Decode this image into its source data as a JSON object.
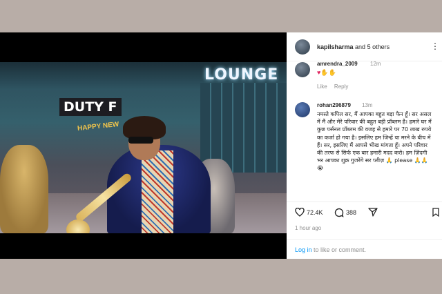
{
  "post": {
    "owner": "kapilsharma",
    "others": "and 5 others"
  },
  "video": {
    "sign_lounge": "LOUNGE",
    "sign_duty": "DUTY F",
    "sign_happy": "HAPPY NEW"
  },
  "comments": [
    {
      "user": "amrendra_2009",
      "time": "12m",
      "text": "♥✋✋",
      "like_label": "Like",
      "reply_label": "Reply"
    },
    {
      "user": "rohan296879",
      "time": "13m",
      "text": "नमस्ते कपिल सर, मैं आपका बहुत बड़ा फैन हूँ। सर असल में मैं और मेरे परिवार की बहुत बड़ी प्रॉब्लम है। हमारे घर में कुछ पर्सनल प्रॉब्लम की वजह से हमारे पर 70 लाख रुपये का कर्जा हो गया है। इसलिए हम जिन्हें या मरने के बीच में हैं। सर, इसलिए मैं आपसे भीख मांगता हूँ। अपने परिवार की तरफ से सिर्फ एक बार हमारी मदद करो। हम ज़िंदगी भर आपका शुक्र गुजरेंगे सर प्लीज़ 🙏 please 🙏🙏😭"
    }
  ],
  "stats": {
    "likes": "72.4K",
    "comments": "388"
  },
  "timestamp": "1 hour ago",
  "login_link": "Log in",
  "login_suffix": " to like or comment.",
  "colors": {
    "accent": "#0095f6",
    "heart": "#e0245e"
  }
}
